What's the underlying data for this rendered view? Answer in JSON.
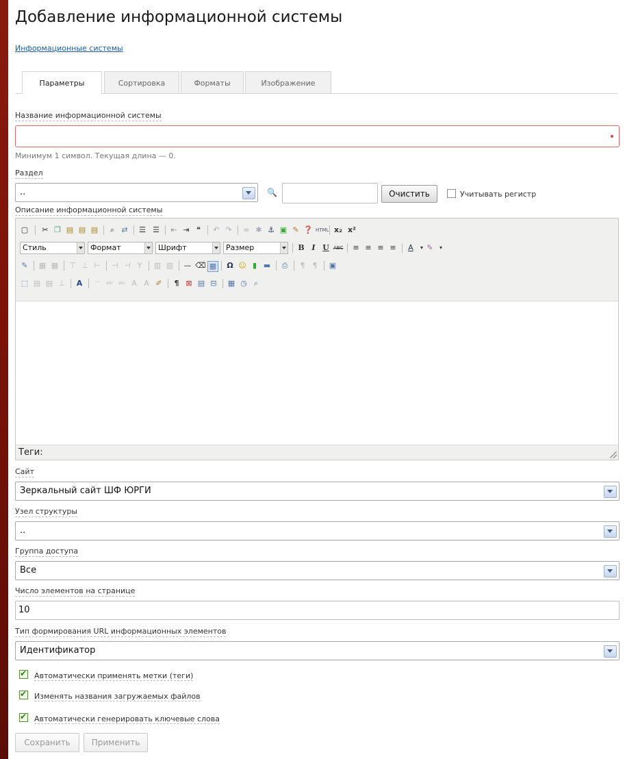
{
  "page": {
    "title": "Добавление информационной системы",
    "breadcrumb": "Информационные системы"
  },
  "tabs": [
    {
      "label": "Параметры",
      "active": true
    },
    {
      "label": "Сортировка",
      "active": false
    },
    {
      "label": "Форматы",
      "active": false
    },
    {
      "label": "Изображение",
      "active": false
    }
  ],
  "form": {
    "name": {
      "label": "Название информационной системы",
      "value": "",
      "hint": "Минимум 1 символ. Текущая длина — 0."
    },
    "section": {
      "label": "Раздел",
      "value": "..",
      "search_value": "",
      "clear_button": "Очистить",
      "case_label": "Учитывать регистр",
      "case_checked": false
    },
    "description": {
      "label": "Описание информационной системы",
      "style_select": "Стиль",
      "format_select": "Формат",
      "font_select": "Шрифт",
      "size_select": "Размер",
      "tags_label": "Теги:"
    },
    "site": {
      "label": "Сайт",
      "value": "Зеркальный сайт ШФ ЮРГИ"
    },
    "structure_node": {
      "label": "Узел структуры",
      "value": ".."
    },
    "access_group": {
      "label": "Группа доступа",
      "value": "Все"
    },
    "items_per_page": {
      "label": "Число элементов на странице",
      "value": "10"
    },
    "url_type": {
      "label": "Тип формирования URL информационных элементов",
      "value": "Идентификатор"
    },
    "checkboxes": [
      {
        "label": "Автоматически применять метки (теги)",
        "checked": true
      },
      {
        "label": "Изменять названия загружаемых файлов",
        "checked": true
      },
      {
        "label": "Автоматически генерировать ключевые слова",
        "checked": true
      }
    ],
    "save_button": "Сохранить",
    "apply_button": "Применить"
  },
  "colors": {
    "frame": "#8b1a0e",
    "link": "#1a5aa8",
    "check": "#2e7d1e",
    "error_border": "#d66"
  }
}
